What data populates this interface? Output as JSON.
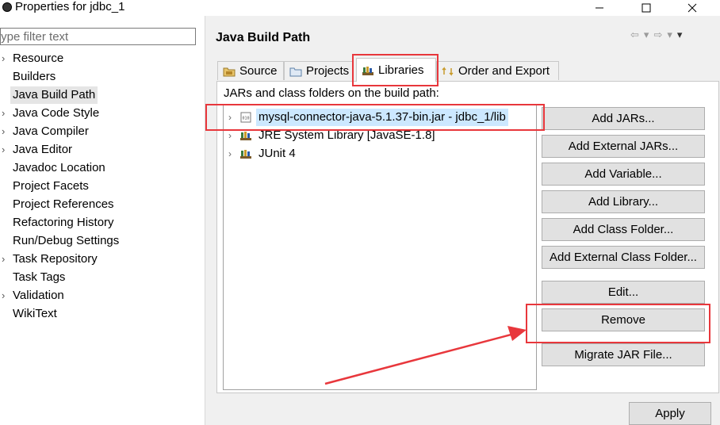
{
  "window": {
    "title": "Properties for jdbc_1"
  },
  "filter": {
    "placeholder": "type filter text"
  },
  "nav": {
    "items": [
      {
        "label": "Resource",
        "expandable": true
      },
      {
        "label": "Builders",
        "expandable": false
      },
      {
        "label": "Java Build Path",
        "expandable": false,
        "selected": true
      },
      {
        "label": "Java Code Style",
        "expandable": true
      },
      {
        "label": "Java Compiler",
        "expandable": true
      },
      {
        "label": "Java Editor",
        "expandable": true
      },
      {
        "label": "Javadoc Location",
        "expandable": false
      },
      {
        "label": "Project Facets",
        "expandable": false
      },
      {
        "label": "Project References",
        "expandable": false
      },
      {
        "label": "Refactoring History",
        "expandable": false
      },
      {
        "label": "Run/Debug Settings",
        "expandable": false
      },
      {
        "label": "Task Repository",
        "expandable": true
      },
      {
        "label": "Task Tags",
        "expandable": false
      },
      {
        "label": "Validation",
        "expandable": true
      },
      {
        "label": "WikiText",
        "expandable": false
      }
    ]
  },
  "page": {
    "title": "Java Build Path"
  },
  "tabs": [
    {
      "label": "Source",
      "icon": "source-folder-icon"
    },
    {
      "label": "Projects",
      "icon": "projects-icon"
    },
    {
      "label": "Libraries",
      "icon": "libraries-icon",
      "active": true
    },
    {
      "label": "Order and Export",
      "icon": "order-export-icon"
    }
  ],
  "libraries": {
    "section_label": "JARs and class folders on the build path:",
    "entries": [
      {
        "label": "mysql-connector-java-5.1.37-bin.jar - jdbc_1/lib",
        "icon": "jar-file-icon",
        "selected": true
      },
      {
        "label": "JRE System Library [JavaSE-1.8]",
        "icon": "library-icon"
      },
      {
        "label": "JUnit 4",
        "icon": "library-icon"
      }
    ],
    "buttons": {
      "add_jars": "Add JARs...",
      "add_external_jars": "Add External JARs...",
      "add_variable": "Add Variable...",
      "add_library": "Add Library...",
      "add_class_folder": "Add Class Folder...",
      "add_external_class_folder": "Add External Class Folder...",
      "edit": "Edit...",
      "remove": "Remove",
      "migrate_jar": "Migrate JAR File..."
    }
  },
  "footer": {
    "apply": "Apply"
  },
  "colors": {
    "annotation": "#e8373c",
    "selection": "#cce8ff",
    "button_bg": "#e1e1e1"
  }
}
